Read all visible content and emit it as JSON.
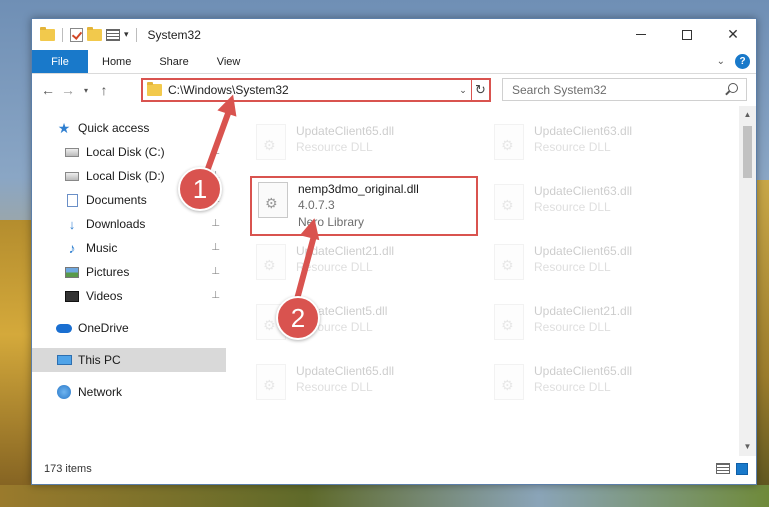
{
  "window": {
    "title": "System32",
    "controls": [
      "minimize",
      "maximize",
      "close"
    ]
  },
  "ribbon": {
    "tabs": [
      "File",
      "Home",
      "Share",
      "View"
    ]
  },
  "navbar": {
    "address": "C:\\Windows\\System32",
    "search_placeholder": "Search System32"
  },
  "sidebar": {
    "items": [
      {
        "label": "Quick access",
        "icon": "star-icon"
      },
      {
        "label": "Local Disk (C:)",
        "icon": "disk-icon"
      },
      {
        "label": "Local Disk (D:)",
        "icon": "disk-icon"
      },
      {
        "label": "Documents",
        "icon": "documents-icon"
      },
      {
        "label": "Downloads",
        "icon": "downloads-icon"
      },
      {
        "label": "Music",
        "icon": "music-icon"
      },
      {
        "label": "Pictures",
        "icon": "pictures-icon"
      },
      {
        "label": "Videos",
        "icon": "videos-icon"
      },
      {
        "label": "OneDrive",
        "icon": "cloud-icon"
      },
      {
        "label": "This PC",
        "icon": "computer-icon"
      },
      {
        "label": "Network",
        "icon": "network-icon"
      }
    ]
  },
  "files": {
    "left": [
      {
        "name": "UpdateClient65.dll",
        "meta": "Resource DLL"
      },
      {
        "name": "nemp3dmo_original.dll",
        "version": "4.0.7.3",
        "meta": "Nero Library"
      },
      {
        "name": "UpdateClient21.dll",
        "meta": "Resource DLL"
      },
      {
        "name": "UpdateClient5.dll",
        "meta": "Resource DLL"
      },
      {
        "name": "UpdateClient65.dll",
        "meta": "Resource DLL"
      }
    ],
    "right": [
      {
        "name": "UpdateClient63.dll",
        "meta": "Resource DLL"
      },
      {
        "name": "UpdateClient63.dll",
        "meta": "Resource DLL"
      },
      {
        "name": "UpdateClient65.dll",
        "meta": "Resource DLL"
      },
      {
        "name": "UpdateClient21.dll",
        "meta": "Resource DLL"
      },
      {
        "name": "UpdateClient65.dll",
        "meta": "Resource DLL"
      }
    ]
  },
  "status": {
    "items_count": "173 items"
  },
  "annotations": {
    "step1": "1",
    "step2": "2",
    "color": "#d9534f"
  }
}
